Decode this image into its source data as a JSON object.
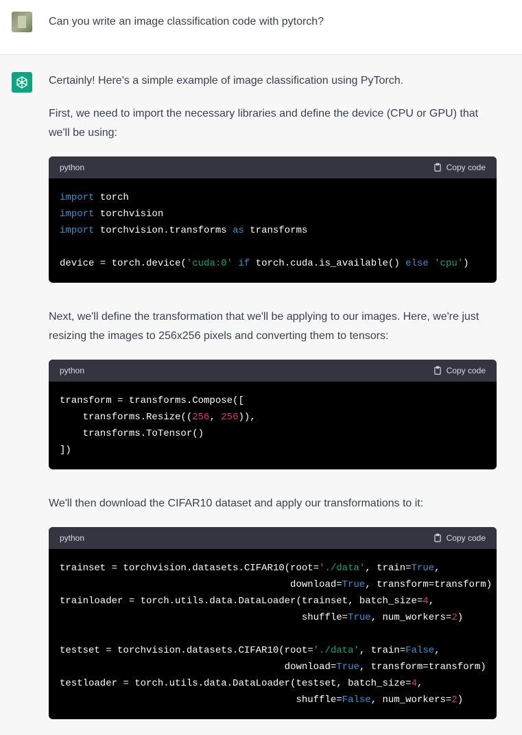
{
  "user_message": {
    "text": "Can you write an image classification code with pytorch?"
  },
  "assistant": {
    "intro": "Certainly! Here's a simple example of image classification using PyTorch.",
    "para1": "First, we need to import the necessary libraries and define the device (CPU or GPU) that we'll be using:",
    "para2": "Next, we'll define the transformation that we'll be applying to our images. Here, we're just resizing the images to 256x256 pixels and converting them to tensors:",
    "para3": "We'll then download the CIFAR10 dataset and apply our transformations to it:",
    "code_blocks": [
      {
        "language": "python",
        "copy_label": "Copy code",
        "lines": [
          [
            [
              "kw",
              "import"
            ],
            [
              "t",
              " torch"
            ]
          ],
          [
            [
              "kw",
              "import"
            ],
            [
              "t",
              " torchvision"
            ]
          ],
          [
            [
              "kw",
              "import"
            ],
            [
              "t",
              " torchvision.transforms "
            ],
            [
              "kw",
              "as"
            ],
            [
              "t",
              " transforms"
            ]
          ],
          [],
          [
            [
              "t",
              "device = torch.device("
            ],
            [
              "str",
              "'cuda:0'"
            ],
            [
              "t",
              " "
            ],
            [
              "kw",
              "if"
            ],
            [
              "t",
              " torch.cuda.is_available() "
            ],
            [
              "kw",
              "else"
            ],
            [
              "t",
              " "
            ],
            [
              "str",
              "'cpu'"
            ],
            [
              "t",
              ")"
            ]
          ]
        ]
      },
      {
        "language": "python",
        "copy_label": "Copy code",
        "lines": [
          [
            [
              "t",
              "transform = transforms.Compose(["
            ]
          ],
          [
            [
              "t",
              "    transforms.Resize(("
            ],
            [
              "num",
              "256"
            ],
            [
              "t",
              ", "
            ],
            [
              "num",
              "256"
            ],
            [
              "t",
              ")),"
            ]
          ],
          [
            [
              "t",
              "    transforms.ToTensor()"
            ]
          ],
          [
            [
              "t",
              "])"
            ]
          ]
        ]
      },
      {
        "language": "python",
        "copy_label": "Copy code",
        "lines": [
          [
            [
              "t",
              "trainset = torchvision.datasets.CIFAR10(root="
            ],
            [
              "str",
              "'./data'"
            ],
            [
              "t",
              ", train="
            ],
            [
              "kw",
              "True"
            ],
            [
              "t",
              ","
            ]
          ],
          [
            [
              "t",
              "                                        download="
            ],
            [
              "kw",
              "True"
            ],
            [
              "t",
              ", transform=transform)"
            ]
          ],
          [
            [
              "t",
              "trainloader = torch.utils.data.DataLoader(trainset, batch_size="
            ],
            [
              "num",
              "4"
            ],
            [
              "t",
              ","
            ]
          ],
          [
            [
              "t",
              "                                          shuffle="
            ],
            [
              "kw",
              "True"
            ],
            [
              "t",
              ", num_workers="
            ],
            [
              "num",
              "2"
            ],
            [
              "t",
              ")"
            ]
          ],
          [],
          [
            [
              "t",
              "testset = torchvision.datasets.CIFAR10(root="
            ],
            [
              "str",
              "'./data'"
            ],
            [
              "t",
              ", train="
            ],
            [
              "kw",
              "False"
            ],
            [
              "t",
              ","
            ]
          ],
          [
            [
              "t",
              "                                       download="
            ],
            [
              "kw",
              "True"
            ],
            [
              "t",
              ", transform=transform)"
            ]
          ],
          [
            [
              "t",
              "testloader = torch.utils.data.DataLoader(testset, batch_size="
            ],
            [
              "num",
              "4"
            ],
            [
              "t",
              ","
            ]
          ],
          [
            [
              "t",
              "                                         shuffle="
            ],
            [
              "kw",
              "False"
            ],
            [
              "t",
              ", num_workers="
            ],
            [
              "num",
              "2"
            ],
            [
              "t",
              ")"
            ]
          ]
        ]
      }
    ]
  },
  "colors": {
    "keyword": "#2e95d3",
    "string": "#00a67d",
    "number": "#df3079",
    "code_bg": "#000000",
    "code_header_bg": "#343541",
    "assistant_avatar": "#10a37f"
  },
  "icons": {
    "assistant_avatar": "openai-logo-icon",
    "copy": "clipboard-icon"
  }
}
